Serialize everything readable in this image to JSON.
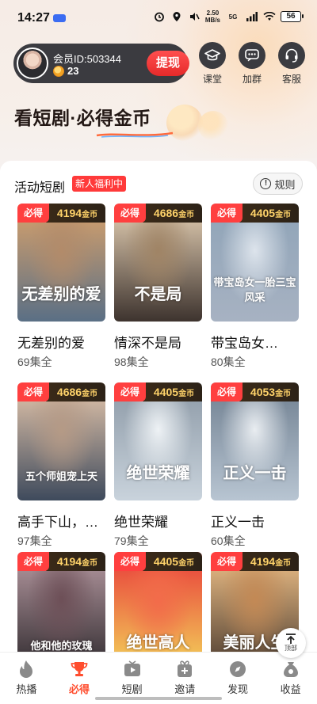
{
  "status_bar": {
    "time": "14:27",
    "net_speed_value": "2.50",
    "net_speed_unit": "MB/s",
    "network_type": "5G",
    "battery": "56"
  },
  "member": {
    "id_label": "会员ID:503344",
    "coins": "23",
    "withdraw_label": "提现"
  },
  "top_actions": [
    {
      "label": "课堂",
      "icon": "graduation-cap-icon"
    },
    {
      "label": "加群",
      "icon": "chat-bubble-icon"
    },
    {
      "label": "客服",
      "icon": "headset-icon"
    }
  ],
  "hero": {
    "title": "看短剧·必得金币"
  },
  "section": {
    "title": "活动短剧",
    "badge": "新人福利中",
    "rules_label": "规则",
    "must_get_label": "必得",
    "coin_unit": "金币"
  },
  "dramas": [
    {
      "title": "无差别的爱",
      "episodes": "69集全",
      "coins": "4194",
      "poster_text": "无差别的爱"
    },
    {
      "title": "情深不是局",
      "episodes": "98集全",
      "coins": "4686",
      "poster_text": "不是局"
    },
    {
      "title": "带宝岛女…",
      "episodes": "80集全",
      "coins": "4405",
      "poster_text": "带宝岛女一胎三宝风采"
    },
    {
      "title": "高手下山，…",
      "episodes": "97集全",
      "coins": "4686",
      "poster_text": "五个师姐宠上天"
    },
    {
      "title": "绝世荣耀",
      "episodes": "79集全",
      "coins": "4405",
      "poster_text": "绝世荣耀"
    },
    {
      "title": "正义一击",
      "episodes": "60集全",
      "coins": "4053",
      "poster_text": "正义一击"
    },
    {
      "title": "",
      "episodes": "",
      "coins": "4194",
      "poster_text": "他和他的玫瑰"
    },
    {
      "title": "",
      "episodes": "",
      "coins": "4405",
      "poster_text": "绝世高人"
    },
    {
      "title": "",
      "episodes": "",
      "coins": "4194",
      "poster_text": "美丽人生"
    }
  ],
  "scroll_top_label": "顶部",
  "bottom_nav": [
    {
      "label": "热播",
      "icon": "flame-icon",
      "active": false
    },
    {
      "label": "必得",
      "icon": "trophy-icon",
      "active": true
    },
    {
      "label": "短剧",
      "icon": "tv-play-icon",
      "active": false
    },
    {
      "label": "邀请",
      "icon": "gift-add-icon",
      "active": false
    },
    {
      "label": "发现",
      "icon": "compass-icon",
      "active": false
    },
    {
      "label": "收益",
      "icon": "coin-bag-icon",
      "active": false
    }
  ],
  "colors": {
    "accent_red": "#ff3f3f",
    "coin_gold": "#ffd36a",
    "pill_dark": "#3b3b40",
    "nav_active": "#ff4d2e"
  }
}
